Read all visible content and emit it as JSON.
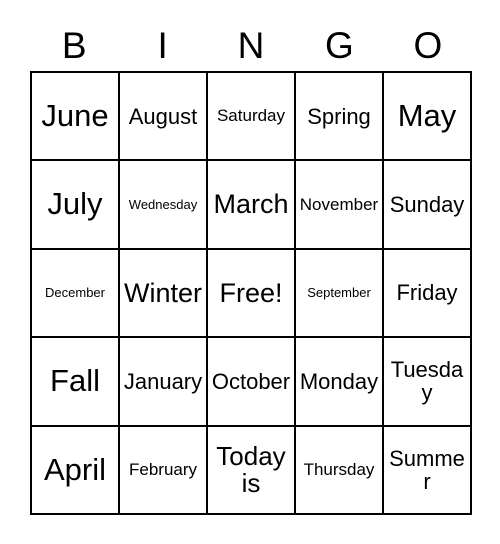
{
  "card": {
    "header_letters": [
      "B",
      "I",
      "N",
      "G",
      "O"
    ],
    "rows": [
      [
        {
          "text": "June",
          "size": "xl"
        },
        {
          "text": "August",
          "size": "md"
        },
        {
          "text": "Saturday",
          "size": "sm"
        },
        {
          "text": "Spring",
          "size": "md"
        },
        {
          "text": "May",
          "size": "xl"
        }
      ],
      [
        {
          "text": "July",
          "size": "xl"
        },
        {
          "text": "Wednesday",
          "size": "xs"
        },
        {
          "text": "March",
          "size": "lg"
        },
        {
          "text": "November",
          "size": "sm"
        },
        {
          "text": "Sunday",
          "size": "md"
        }
      ],
      [
        {
          "text": "December",
          "size": "xs"
        },
        {
          "text": "Winter",
          "size": "lg"
        },
        {
          "text": "Free!",
          "size": "lg"
        },
        {
          "text": "September",
          "size": "xs"
        },
        {
          "text": "Friday",
          "size": "md"
        }
      ],
      [
        {
          "text": "Fall",
          "size": "xl"
        },
        {
          "text": "January",
          "size": "md"
        },
        {
          "text": "October",
          "size": "md"
        },
        {
          "text": "Monday",
          "size": "md"
        },
        {
          "text": "Tuesday",
          "size": "md"
        }
      ],
      [
        {
          "text": "April",
          "size": "xl"
        },
        {
          "text": "February",
          "size": "sm"
        },
        {
          "text": "Today is",
          "size": "wrap"
        },
        {
          "text": "Thursday",
          "size": "sm"
        },
        {
          "text": "Summer",
          "size": "md"
        }
      ]
    ],
    "free_space": {
      "row": 2,
      "col": 2,
      "label": "Free!"
    },
    "colors": {
      "border": "#000000",
      "text": "#000000",
      "background": "#ffffff"
    }
  }
}
